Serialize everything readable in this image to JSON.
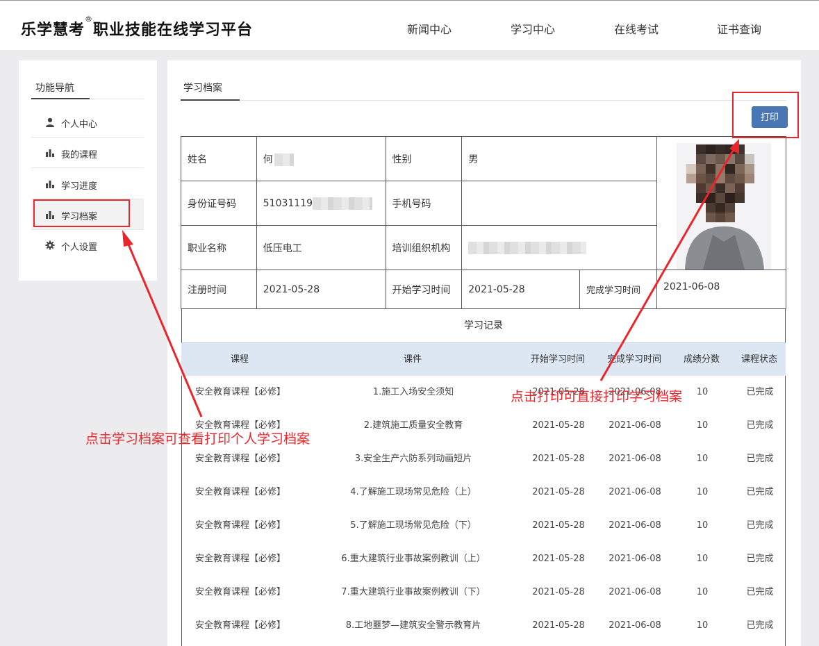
{
  "header": {
    "logo_text": "乐学慧考",
    "logo_reg": "®",
    "logo_subtitle": "职业技能在线学习平台",
    "nav": [
      "新闻中心",
      "学习中心",
      "在线考试",
      "证书查询"
    ]
  },
  "sidebar": {
    "title": "功能导航",
    "items": [
      {
        "label": "个人中心",
        "icon": "user-icon"
      },
      {
        "label": "我的课程",
        "icon": "bar-chart-icon"
      },
      {
        "label": "学习进度",
        "icon": "bar-chart-icon"
      },
      {
        "label": "学习档案",
        "icon": "bar-chart-icon",
        "active": true
      },
      {
        "label": "个人设置",
        "icon": "gear-icon"
      }
    ]
  },
  "main": {
    "tab": "学习档案",
    "print_label": "打印",
    "profile": {
      "name_label": "姓名",
      "name_value": "何",
      "gender_label": "性别",
      "gender_value": "男",
      "id_label": "身份证号码",
      "id_value": "51031119",
      "phone_label": "手机号码",
      "phone_value": "",
      "job_label": "职业名称",
      "job_value": "低压电工",
      "org_label": "培训组织机构",
      "org_value": "",
      "reg_label": "注册时间",
      "reg_value": "2021-05-28",
      "start_label": "开始学习时间",
      "start_value": "2021-05-28",
      "finish_label": "完成学习时间",
      "finish_value": "2021-06-08"
    },
    "records_title": "学习记录",
    "columns": [
      "课程",
      "课件",
      "开始学习时间",
      "完成学习时间",
      "成绩分数",
      "课程状态"
    ],
    "rows": [
      [
        "安全教育课程【必修】",
        "1.施工入场安全须知",
        "2021-05-28",
        "2021-06-08",
        "10",
        "已完成"
      ],
      [
        "安全教育课程【必修】",
        "2.建筑施工质量安全教育",
        "2021-05-28",
        "2021-06-08",
        "10",
        "已完成"
      ],
      [
        "安全教育课程【必修】",
        "3.安全生产六防系列动画短片",
        "2021-05-28",
        "2021-06-08",
        "10",
        "已完成"
      ],
      [
        "安全教育课程【必修】",
        "4.了解施工现场常见危险（上）",
        "2021-05-28",
        "2021-06-08",
        "10",
        "已完成"
      ],
      [
        "安全教育课程【必修】",
        "5.了解施工现场常见危险（下）",
        "2021-05-28",
        "2021-06-08",
        "10",
        "已完成"
      ],
      [
        "安全教育课程【必修】",
        "6.重大建筑行业事故案例教训（上）",
        "2021-05-28",
        "2021-06-08",
        "10",
        "已完成"
      ],
      [
        "安全教育课程【必修】",
        "7.重大建筑行业事故案例教训（下）",
        "2021-05-28",
        "2021-06-08",
        "10",
        "已完成"
      ],
      [
        "安全教育课程【必修】",
        "8.工地噩梦—建筑安全警示教育片",
        "2021-05-28",
        "2021-06-08",
        "10",
        "已完成"
      ]
    ]
  },
  "annotations": {
    "left": "点击学习档案可查看打印个人学习档案",
    "right": "点击打印可直接打印学习档案"
  },
  "colors": {
    "accent": "#4a77b4",
    "annotation": "#e8262b",
    "table_header": "#dce7f3"
  }
}
